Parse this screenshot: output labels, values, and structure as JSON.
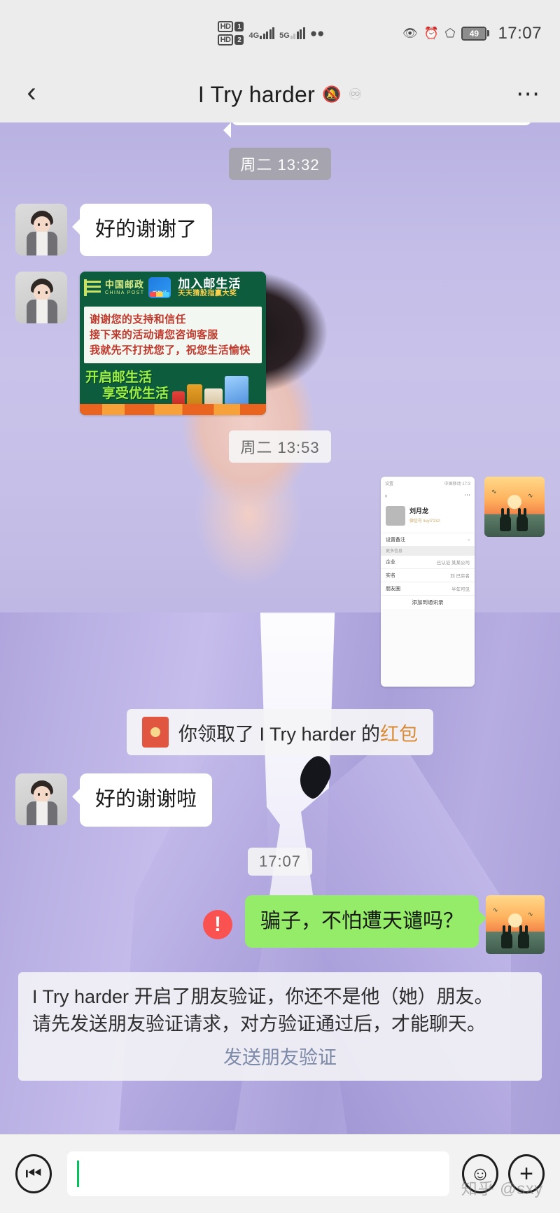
{
  "status_bar": {
    "hd_labels": [
      "HD",
      "HD"
    ],
    "sim_numbers": [
      "1",
      "2"
    ],
    "network_1": "4G",
    "network_2": "5G",
    "wechat_icon": "wechat-icon",
    "eye_icon": "eye-protect-icon",
    "alarm_icon": "alarm-icon",
    "bluetooth_icon": "bluetooth-icon",
    "battery_percent": "49",
    "time": "17:07"
  },
  "nav": {
    "back_icon": "back-chevron-icon",
    "title": "I Try harder",
    "mute_icon": "bell-muted-icon",
    "listen_icon": "ear-icon",
    "more_icon": "more-dots-icon"
  },
  "messages": [
    {
      "type": "timestamp",
      "text": "周二 13:32",
      "style": "dark"
    },
    {
      "type": "incoming_text",
      "text": "好的谢谢了"
    },
    {
      "type": "incoming_image_chinapost"
    },
    {
      "type": "timestamp",
      "text": "周二 13:53",
      "style": "light"
    },
    {
      "type": "outgoing_screenshot"
    },
    {
      "type": "redpacket_notice"
    },
    {
      "type": "incoming_text_2",
      "text": "好的谢谢啦"
    },
    {
      "type": "timestamp",
      "text": "17:07",
      "style": "light"
    },
    {
      "type": "outgoing_green",
      "text": "骗子，不怕遭天谴吗？"
    },
    {
      "type": "system_notice"
    }
  ],
  "bubbles": {
    "msg_thanks_1": "好的谢谢了",
    "msg_thanks_2": "好的谢谢啦",
    "msg_green": "骗子，不怕遭天谴吗？"
  },
  "timestamps": {
    "t1": "周二 13:32",
    "t2": "周二 13:53",
    "t3": "17:07"
  },
  "china_post_image": {
    "brand_cn": "中国邮政",
    "brand_en": "CHINA POST",
    "app_badge": "邮生活",
    "slogan_main": "加入邮生活",
    "slogan_sub": "天天猜股指赢大奖",
    "body_line_1": "谢谢您的支持和信任",
    "body_line_2": "接下来的活动请您咨询客服",
    "body_line_3": "我就先不打扰您了，祝您生活愉快",
    "footer_line_1": "开启邮生活",
    "footer_line_2": "享受优生活",
    "theme_color": "#0c5c3d",
    "body_text_color": "#c0392b",
    "footer_text_color": "#9cf046"
  },
  "profile_screenshot": {
    "status_left": "设置",
    "status_right": "中国移动 17:3",
    "back_icon": "back-chevron-icon",
    "more_icon": "more-dots-icon",
    "name": "刘月龙",
    "gender_icon": "male-icon",
    "tag": "微信号 liuyl7132",
    "row_1_label": "设置备注",
    "section_label": "更多信息",
    "row_2_label": "企业",
    "row_2_value": "已认证 某某公司",
    "row_3_label": "实名",
    "row_3_value": "刘 已实名",
    "row_4_label": "朋友圈",
    "row_4_value": "半年可见",
    "button_label": "添加到通讯录"
  },
  "redpacket": {
    "icon": "red-packet-icon",
    "prefix": "你领取了 I Try harder 的",
    "highlight": "红包",
    "highlight_color": "#d98a33"
  },
  "system_notice": {
    "line_1": "I Try harder 开启了朋友验证，你还不是他（她）朋友。",
    "line_2": "请先发送朋友验证请求，对方验证通过后，才能聊天。",
    "link": "发送朋友验证",
    "link_color": "#7c8aa8"
  },
  "error_badge": {
    "symbol": "!",
    "color": "#fa5151"
  },
  "input_bar": {
    "voice_icon": "voice-input-icon",
    "text_value": "",
    "placeholder": "",
    "emoji_icon": "emoji-icon",
    "plus_icon": "plus-icon"
  },
  "watermark": "知乎 @sxy",
  "colors": {
    "outgoing_bubble": "#95ec69",
    "incoming_bubble": "#ffffff",
    "chrome": "#ececec",
    "input_bar": "#f2f2f2",
    "cursor": "#07c160"
  }
}
